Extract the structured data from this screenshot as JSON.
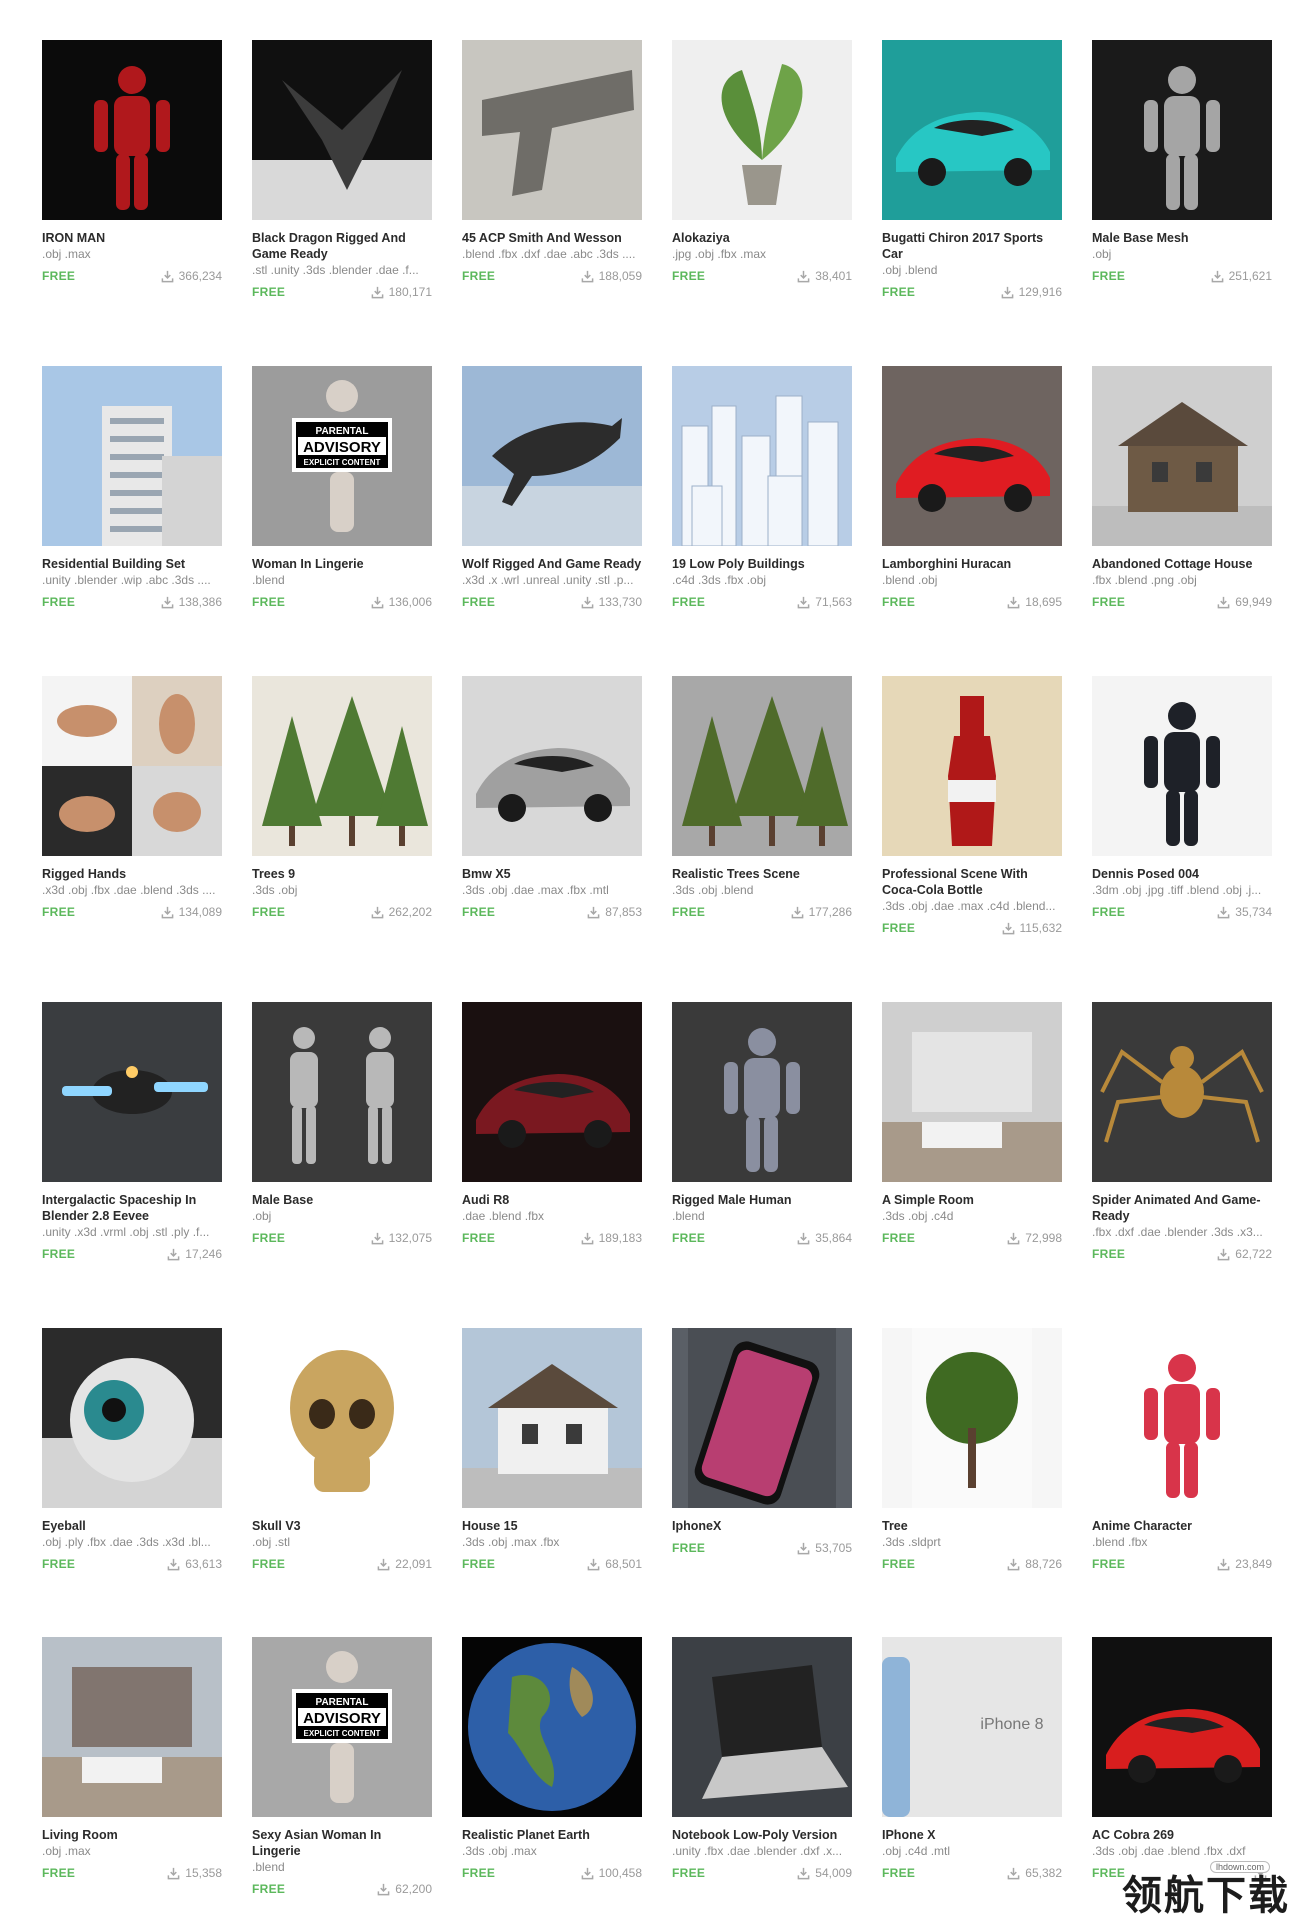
{
  "cards": [
    {
      "title": "IRON MAN",
      "formats": ".obj .max",
      "price": "FREE",
      "downloads": "366,234",
      "bg": "#0b0b0b",
      "fg": "#b0181c",
      "shape": "figure"
    },
    {
      "title": "Black Dragon Rigged And Game Ready",
      "formats": ".stl .unity .3ds .blender .dae .f...",
      "price": "FREE",
      "downloads": "180,171",
      "bg": "#101010",
      "fg": "#3c3c3c",
      "shape": "dragon"
    },
    {
      "title": "45 ACP Smith And Wesson",
      "formats": ".blend .fbx .dxf .dae .abc .3ds ....",
      "price": "FREE",
      "downloads": "188,059",
      "bg": "#c8c6c0",
      "fg": "#6f6d68",
      "shape": "gun"
    },
    {
      "title": "Alokaziya",
      "formats": ".jpg .obj .fbx .max",
      "price": "FREE",
      "downloads": "38,401",
      "bg": "#efefef",
      "fg": "#5a8f3a",
      "shape": "plant"
    },
    {
      "title": "Bugatti Chiron 2017 Sports Car",
      "formats": ".obj .blend",
      "price": "FREE",
      "downloads": "129,916",
      "bg": "#1f9e9a",
      "fg": "#27c7c4",
      "shape": "car"
    },
    {
      "title": "Male Base Mesh",
      "formats": ".obj",
      "price": "FREE",
      "downloads": "251,621",
      "bg": "#1a1a1a",
      "fg": "#a5a5a5",
      "shape": "figure"
    },
    {
      "title": "Residential Building Set",
      "formats": ".unity .blender .wip .abc .3ds ....",
      "price": "FREE",
      "downloads": "138,386",
      "bg": "#a9c7e6",
      "fg": "#e8e8e8",
      "shape": "building"
    },
    {
      "title": "Woman In Lingerie",
      "formats": ".blend",
      "price": "FREE",
      "downloads": "136,006",
      "bg": "#9c9c9c",
      "fg": "#d8d0c8",
      "shape": "advisory"
    },
    {
      "title": "Wolf Rigged And Game Ready",
      "formats": ".x3d .x .wrl .unreal .unity .stl .p...",
      "price": "FREE",
      "downloads": "133,730",
      "bg": "#9db8d6",
      "fg": "#2c2c2c",
      "shape": "wolf"
    },
    {
      "title": "19 Low Poly Buildings",
      "formats": ".c4d .3ds .fbx .obj",
      "price": "FREE",
      "downloads": "71,563",
      "bg": "#b8cde6",
      "fg": "#f2f6fb",
      "shape": "city"
    },
    {
      "title": "Lamborghini Huracan",
      "formats": ".blend .obj",
      "price": "FREE",
      "downloads": "18,695",
      "bg": "#6e6460",
      "fg": "#e01c22",
      "shape": "car"
    },
    {
      "title": "Abandoned Cottage House",
      "formats": ".fbx .blend .png .obj",
      "price": "FREE",
      "downloads": "69,949",
      "bg": "#cfcfcf",
      "fg": "#6e5a45",
      "shape": "house"
    },
    {
      "title": "Rigged Hands",
      "formats": ".x3d .obj .fbx .dae .blend .3ds ....",
      "price": "FREE",
      "downloads": "134,089",
      "bg": "#4a4a4a",
      "fg": "#c7906c",
      "shape": "hands"
    },
    {
      "title": "Trees 9",
      "formats": ".3ds .obj",
      "price": "FREE",
      "downloads": "262,202",
      "bg": "#eae6dc",
      "fg": "#4f7a33",
      "shape": "trees"
    },
    {
      "title": "Bmw X5",
      "formats": ".3ds .obj .dae .max .fbx .mtl",
      "price": "FREE",
      "downloads": "87,853",
      "bg": "#d8d8d8",
      "fg": "#a0a0a0",
      "shape": "car"
    },
    {
      "title": "Realistic Trees Scene",
      "formats": ".3ds .obj .blend",
      "price": "FREE",
      "downloads": "177,286",
      "bg": "#a8a8a8",
      "fg": "#4f6b2a",
      "shape": "trees"
    },
    {
      "title": "Professional Scene With Coca-Cola Bottle",
      "formats": ".3ds .obj .dae .max .c4d .blend...",
      "price": "FREE",
      "downloads": "115,632",
      "bg": "#e6d8b8",
      "fg": "#b01818",
      "shape": "bottle"
    },
    {
      "title": "Dennis Posed 004",
      "formats": ".3dm .obj .jpg .tiff .blend .obj .j...",
      "price": "FREE",
      "downloads": "35,734",
      "bg": "#f4f4f4",
      "fg": "#1e2128",
      "shape": "figure"
    },
    {
      "title": "Intergalactic Spaceship In Blender 2.8 Eevee",
      "formats": ".unity .x3d .vrml .obj .stl .ply .f...",
      "price": "FREE",
      "downloads": "17,246",
      "bg": "#3a3d40",
      "fg": "#8fd6ff",
      "shape": "ship"
    },
    {
      "title": "Male Base",
      "formats": ".obj",
      "price": "FREE",
      "downloads": "132,075",
      "bg": "#3a3a3a",
      "fg": "#b8b8b8",
      "shape": "twofigures"
    },
    {
      "title": "Audi R8",
      "formats": ".dae .blend .fbx",
      "price": "FREE",
      "downloads": "189,183",
      "bg": "#1a1010",
      "fg": "#7a1820",
      "shape": "car"
    },
    {
      "title": "Rigged Male Human",
      "formats": ".blend",
      "price": "FREE",
      "downloads": "35,864",
      "bg": "#3a3a3a",
      "fg": "#8a8fa0",
      "shape": "figure"
    },
    {
      "title": "A Simple Room",
      "formats": ".3ds .obj .c4d",
      "price": "FREE",
      "downloads": "72,998",
      "bg": "#cfcfcf",
      "fg": "#ececec",
      "shape": "room"
    },
    {
      "title": "Spider Animated And Game-Ready",
      "formats": ".fbx .dxf .dae .blender .3ds .x3...",
      "price": "FREE",
      "downloads": "62,722",
      "bg": "#3a3a3a",
      "fg": "#b8893a",
      "shape": "spider"
    },
    {
      "title": "Eyeball",
      "formats": ".obj .ply .fbx .dae .3ds .x3d .bl...",
      "price": "FREE",
      "downloads": "63,613",
      "bg": "#2b2b2b",
      "fg": "#e4e4e4",
      "shape": "eye"
    },
    {
      "title": "Skull V3",
      "formats": ".obj .stl",
      "price": "FREE",
      "downloads": "22,091",
      "bg": "#ffffff",
      "fg": "#c9a560",
      "shape": "skull"
    },
    {
      "title": "House 15",
      "formats": ".3ds .obj .max .fbx",
      "price": "FREE",
      "downloads": "68,501",
      "bg": "#b4c6d8",
      "fg": "#f0f0f0",
      "shape": "house"
    },
    {
      "title": "IphoneX",
      "formats": "",
      "price": "FREE",
      "downloads": "53,705",
      "bg": "#5a5f66",
      "fg": "#e24a8a",
      "shape": "phone"
    },
    {
      "title": "Tree",
      "formats": ".3ds .sldprt",
      "price": "FREE",
      "downloads": "88,726",
      "bg": "#f6f6f6",
      "fg": "#3f6a22",
      "shape": "tree"
    },
    {
      "title": "Anime Character",
      "formats": ".blend .fbx",
      "price": "FREE",
      "downloads": "23,849",
      "bg": "#ffffff",
      "fg": "#d8344a",
      "shape": "figure"
    },
    {
      "title": "Living Room",
      "formats": ".obj .max",
      "price": "FREE",
      "downloads": "15,358",
      "bg": "#b8c0c8",
      "fg": "#6a5648",
      "shape": "room"
    },
    {
      "title": "Sexy Asian Woman In Lingerie",
      "formats": ".blend",
      "price": "FREE",
      "downloads": "62,200",
      "bg": "#a8a8a8",
      "fg": "#d8d0c8",
      "shape": "advisory"
    },
    {
      "title": "Realistic Planet Earth",
      "formats": ".3ds .obj .max",
      "price": "FREE",
      "downloads": "100,458",
      "bg": "#050505",
      "fg": "#2d5fa8",
      "shape": "earth"
    },
    {
      "title": "Notebook Low-Poly Version",
      "formats": ".unity .fbx .dae .blender .dxf .x...",
      "price": "FREE",
      "downloads": "54,009",
      "bg": "#3c4045",
      "fg": "#c8c8c8",
      "shape": "laptop"
    },
    {
      "title": "IPhone X",
      "formats": ".obj .c4d .mtl",
      "price": "FREE",
      "downloads": "65,382",
      "bg": "#e6e6e6",
      "fg": "#8fb4d8",
      "shape": "iphone8"
    },
    {
      "title": "AC Cobra 269",
      "formats": ".3ds .obj .dae .blend .fbx .dxf",
      "price": "FREE",
      "downloads": "",
      "bg": "#101010",
      "fg": "#d81e1e",
      "shape": "car"
    }
  ],
  "thumb_text": {
    "advisory_line1": "PARENTAL",
    "advisory_line2": "ADVISORY",
    "advisory_line3": "EXPLICIT CONTENT",
    "iphone8_label": "iPhone 8"
  },
  "watermark": {
    "url": "lhdown.com",
    "text": "领航下载"
  },
  "colors": {
    "free_green": "#5cb85c",
    "title_dark": "#2b2b2b",
    "muted_gray": "#8a8a8a"
  }
}
